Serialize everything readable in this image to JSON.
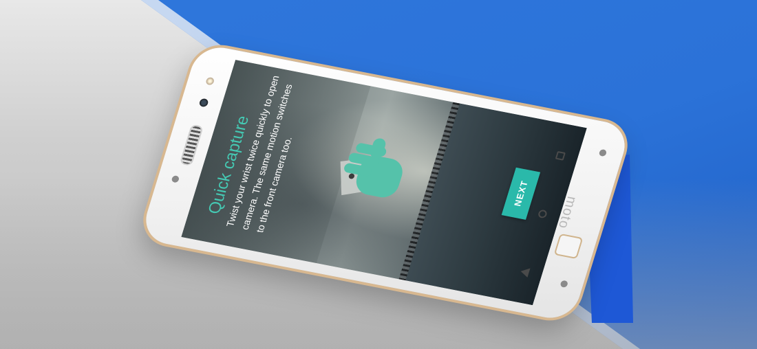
{
  "screen": {
    "title": "Quick capture",
    "body": "Twist your wrist twice quickly to open camera. The same motion switches to the front camera too.",
    "next_label": "NEXT"
  },
  "phone": {
    "brand_label": "moto"
  },
  "icons": {
    "recents": "recents-square-icon",
    "home": "home-circle-icon",
    "back": "back-triangle-icon",
    "illustration": "hand-twist-icon"
  },
  "colors": {
    "accent_teal": "#2ab9aa",
    "title_teal": "#45c9b3",
    "background_blue": "#2f77dc",
    "phone_trim_gold": "#d8b890"
  }
}
